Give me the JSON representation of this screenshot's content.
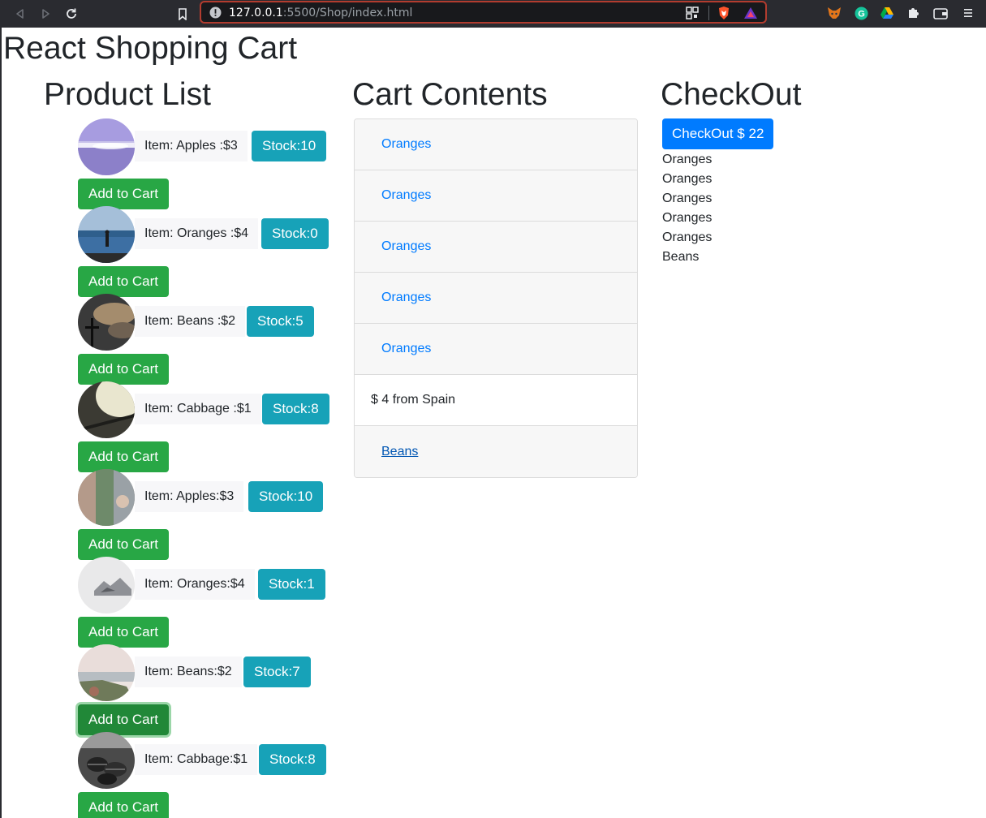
{
  "browser": {
    "url_host": "127.0.0.1",
    "url_rest": ":5500/Shop/index.html"
  },
  "app": {
    "title": "React Shopping Cart"
  },
  "product_list": {
    "title": "Product List",
    "add_label": "Add to Cart",
    "items": [
      {
        "label": "Item: Apples :$3",
        "stock": "Stock:10"
      },
      {
        "label": "Item: Oranges :$4",
        "stock": "Stock:0"
      },
      {
        "label": "Item: Beans :$2",
        "stock": "Stock:5"
      },
      {
        "label": "Item: Cabbage :$1",
        "stock": "Stock:8"
      },
      {
        "label": "Item: Apples:$3",
        "stock": "Stock:10"
      },
      {
        "label": "Item: Oranges:$4",
        "stock": "Stock:1"
      },
      {
        "label": "Item: Beans:$2",
        "stock": "Stock:7"
      },
      {
        "label": "Item: Cabbage:$1",
        "stock": "Stock:8"
      }
    ]
  },
  "cart": {
    "title": "Cart Contents",
    "rows": [
      {
        "text": "Oranges"
      },
      {
        "text": "Oranges"
      },
      {
        "text": "Oranges"
      },
      {
        "text": "Oranges"
      },
      {
        "text": "Oranges"
      },
      {
        "text": "$ 4 from Spain"
      },
      {
        "text": "Beans"
      }
    ]
  },
  "checkout": {
    "title": "CheckOut",
    "button_label": "CheckOut $ 22",
    "items": [
      "Oranges",
      "Oranges",
      "Oranges",
      "Oranges",
      "Oranges",
      "Beans"
    ]
  },
  "colors": {
    "primary": "#007bff",
    "success": "#28a745",
    "info": "#17a2b8"
  }
}
